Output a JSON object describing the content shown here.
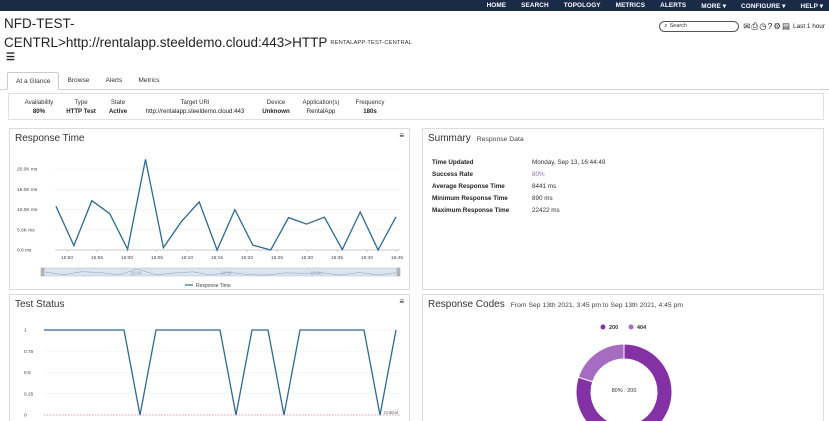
{
  "nav": {
    "items": [
      "HOME",
      "SEARCH",
      "TOPOLOGY",
      "METRICS",
      "ALERTS",
      "MORE ▾",
      "CONFIGURE ▾",
      "HELP ▾"
    ]
  },
  "header": {
    "title_line1": "NFD-TEST-",
    "title_line2": "CENTRL>http://rentalapp.steeldemo.cloud:443>HTTP",
    "subtitle": "RENTALAPP-TEST-CENTRAL",
    "search_placeholder": "Search",
    "time_range": "Last 1 hour"
  },
  "tabs": [
    "At a Glance",
    "Browse",
    "Alerts",
    "Metrics"
  ],
  "info": [
    {
      "label": "Availability",
      "value": "80%"
    },
    {
      "label": "Type",
      "value": "HTTP Test"
    },
    {
      "label": "State",
      "value": "Active"
    },
    {
      "label": "Target URI",
      "value": "http://rentalapp.steeldemo.cloud:443"
    },
    {
      "label": "Device",
      "value": "Unknown"
    },
    {
      "label": "Application(s)",
      "value": "RentalApp"
    },
    {
      "label": "Frequency",
      "value": "180s"
    }
  ],
  "response_time_panel": {
    "title": "Response Time",
    "legend": "Response Time",
    "navigator_labels": [
      "16:00",
      "16:15",
      "16:30"
    ]
  },
  "summary_panel": {
    "title": "Summary",
    "subtitle": "Response Data",
    "rows": [
      {
        "key": "Time Updated",
        "value": "Monday, Sep 13, 16:44:49"
      },
      {
        "key": "Success Rate",
        "value": "80%"
      },
      {
        "key": "Average Response Time",
        "value": "8441 ms"
      },
      {
        "key": "Minimum Response Time",
        "value": "890 ms"
      },
      {
        "key": "Maximum Response Time",
        "value": "22422 ms"
      }
    ]
  },
  "test_status_panel": {
    "title": "Test Status",
    "critical_label": "Critical"
  },
  "response_codes_panel": {
    "title": "Response Codes",
    "subtitle": "From Sep 13th 2021, 3:45 pm to Sep 13th 2021, 4:45 pm",
    "center_label": "80% : 200"
  },
  "chart_data": [
    {
      "type": "line",
      "title": "Response Time",
      "series": [
        {
          "name": "Response Time",
          "x": [
            "15:47",
            "15:50",
            "15:53",
            "15:56",
            "15:59",
            "16:02",
            "16:05",
            "16:08",
            "16:11",
            "16:14",
            "16:17",
            "16:20",
            "16:23",
            "16:26",
            "16:29",
            "16:32",
            "16:35",
            "16:38",
            "16:41",
            "16:44"
          ],
          "values": [
            10800,
            1100,
            12200,
            9000,
            200,
            22400,
            600,
            7000,
            11900,
            0,
            10000,
            1200,
            0,
            8000,
            6400,
            8100,
            100,
            9400,
            0,
            8200
          ]
        }
      ],
      "categories": [
        "15:50",
        "15:55",
        "16:00",
        "16:05",
        "16:10",
        "16:15",
        "16:20",
        "16:25",
        "16:30",
        "16:35",
        "16:40",
        "16:45"
      ],
      "y_ticks": [
        "20.0K ms",
        "15.0K ms",
        "10.0K ms",
        "5.0K ms",
        "0.0 ms"
      ],
      "ylim": [
        0,
        22500
      ],
      "color": "#2e6a8e"
    },
    {
      "type": "line",
      "title": "Test Status",
      "series": [
        {
          "name": "Test Status",
          "values": [
            1,
            1,
            1,
            1,
            1,
            1,
            0,
            1,
            1,
            1,
            1,
            1,
            0,
            1,
            1,
            0,
            1,
            1,
            1,
            1,
            1,
            0,
            1
          ]
        }
      ],
      "y_ticks": [
        "1",
        "0.75",
        "0.5",
        "0.25",
        "0"
      ],
      "ylim": [
        0,
        1
      ],
      "color": "#2e6a8e"
    },
    {
      "type": "pie",
      "title": "Response Codes",
      "labels": [
        "200",
        "404"
      ],
      "values": [
        80,
        20
      ],
      "colors": [
        "#8431a6",
        "#a56cc1"
      ]
    }
  ]
}
